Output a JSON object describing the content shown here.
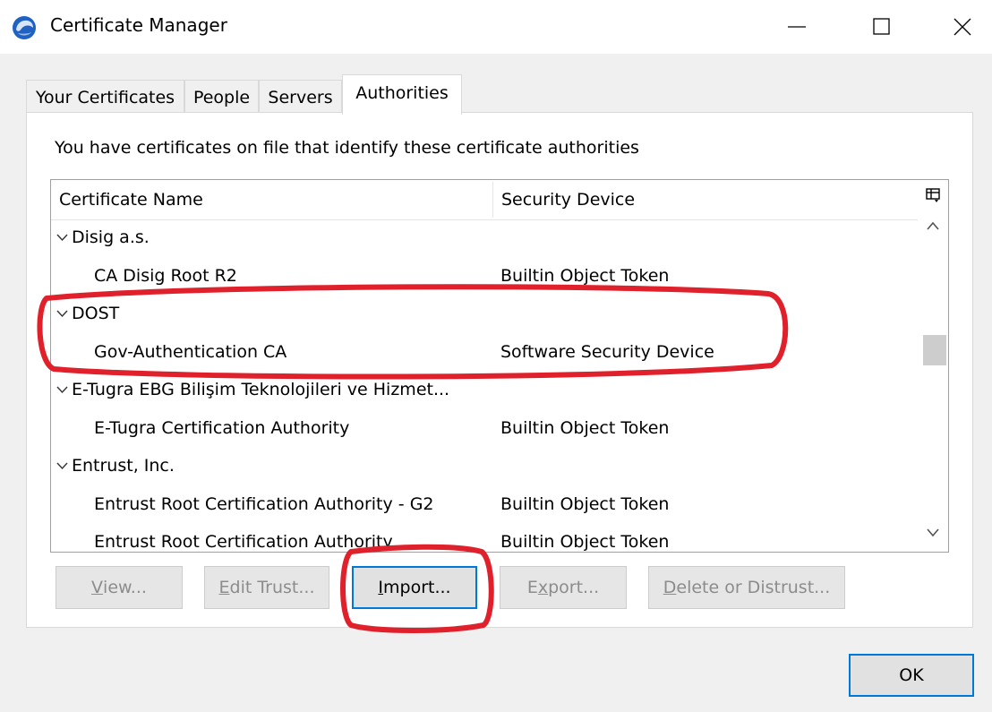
{
  "window": {
    "title": "Certificate Manager",
    "icon": "thunderbird-app-icon"
  },
  "tabs": [
    {
      "label": "Your Certificates",
      "active": false
    },
    {
      "label": "People",
      "active": false
    },
    {
      "label": "Servers",
      "active": false
    },
    {
      "label": "Authorities",
      "active": true
    }
  ],
  "description": "You have certificates on file that identify these certificate authorities",
  "table": {
    "columns": [
      "Certificate Name",
      "Security Device"
    ],
    "rows": [
      {
        "type": "group",
        "name": "Disig a.s.",
        "device": ""
      },
      {
        "type": "cert",
        "name": "CA Disig Root R2",
        "device": "Builtin Object Token"
      },
      {
        "type": "group",
        "name": "DOST",
        "device": ""
      },
      {
        "type": "cert",
        "name": "Gov-Authentication CA",
        "device": "Software Security Device"
      },
      {
        "type": "group",
        "name": "E-Tugra EBG Bilişim Teknolojileri ve Hizmet...",
        "device": ""
      },
      {
        "type": "cert",
        "name": "E-Tugra Certification Authority",
        "device": "Builtin Object Token"
      },
      {
        "type": "group",
        "name": "Entrust, Inc.",
        "device": ""
      },
      {
        "type": "cert",
        "name": "Entrust Root Certification Authority - G2",
        "device": "Builtin Object Token"
      },
      {
        "type": "cert",
        "name": "Entrust Root Certification Authority",
        "device": "Builtin Object Token"
      }
    ]
  },
  "buttons": {
    "view": {
      "mnemonic": "V",
      "rest": "iew..."
    },
    "edit_trust": {
      "mnemonic": "E",
      "rest": "dit Trust..."
    },
    "import": {
      "mnemonic": "I",
      "rest": "mport..."
    },
    "export": {
      "pre": "E",
      "mnemonic": "x",
      "rest": "port..."
    },
    "delete": {
      "mnemonic": "D",
      "rest": "elete or Distrust..."
    },
    "ok": "OK"
  },
  "colors": {
    "annotation": "#e0202a",
    "focus_border": "#0078d7"
  }
}
